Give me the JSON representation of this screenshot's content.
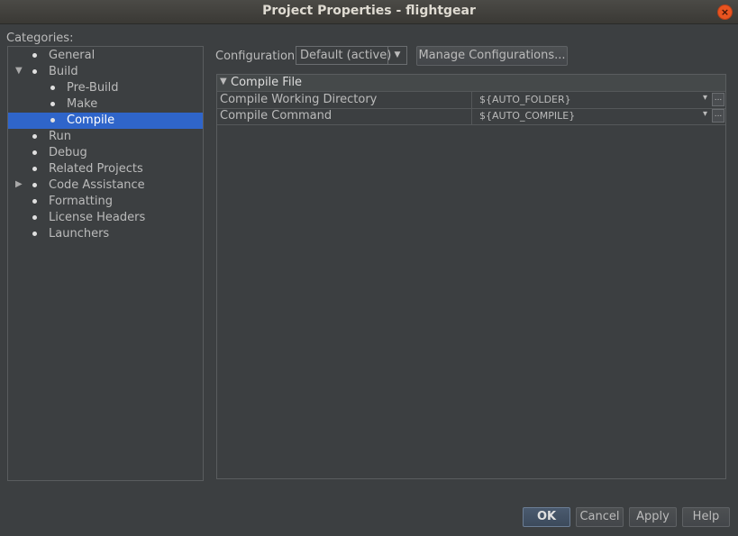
{
  "window": {
    "title": "Project Properties - flightgear",
    "close_label": "×"
  },
  "categories_label": "Categories:",
  "tree": [
    {
      "label": "General",
      "level": 1,
      "expander": "",
      "selected": false
    },
    {
      "label": "Build",
      "level": 1,
      "expander": "▼",
      "selected": false
    },
    {
      "label": "Pre-Build",
      "level": 2,
      "expander": "",
      "selected": false
    },
    {
      "label": "Make",
      "level": 2,
      "expander": "",
      "selected": false
    },
    {
      "label": "Compile",
      "level": 2,
      "expander": "",
      "selected": true
    },
    {
      "label": "Run",
      "level": 1,
      "expander": "",
      "selected": false
    },
    {
      "label": "Debug",
      "level": 1,
      "expander": "",
      "selected": false
    },
    {
      "label": "Related Projects",
      "level": 1,
      "expander": "",
      "selected": false
    },
    {
      "label": "Code Assistance",
      "level": 1,
      "expander": "▶",
      "selected": false
    },
    {
      "label": "Formatting",
      "level": 1,
      "expander": "",
      "selected": false
    },
    {
      "label": "License Headers",
      "level": 1,
      "expander": "",
      "selected": false
    },
    {
      "label": "Launchers",
      "level": 1,
      "expander": "",
      "selected": false
    }
  ],
  "configuration": {
    "label": "Configuration:",
    "selected": "Default (active)",
    "manage_label": "Manage Configurations..."
  },
  "properties": {
    "section_title": "Compile File",
    "rows": [
      {
        "name": "Compile Working Directory",
        "value": "${AUTO_FOLDER}"
      },
      {
        "name": "Compile Command",
        "value": "${AUTO_COMPILE}"
      }
    ],
    "ellipsis_label": "..."
  },
  "buttons": {
    "ok": "OK",
    "cancel": "Cancel",
    "apply": "Apply",
    "help": "Help"
  },
  "colors": {
    "selection": "#2f65ca",
    "background": "#3c3f41",
    "close": "#e95420"
  }
}
